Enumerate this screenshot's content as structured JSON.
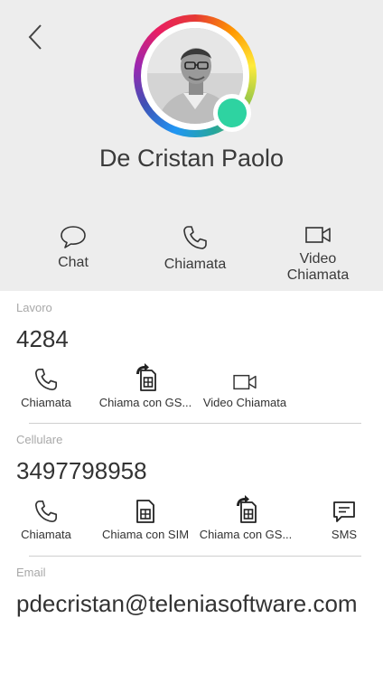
{
  "contact": {
    "name": "De Cristan Paolo",
    "status_color": "#2ed3a1"
  },
  "quick_actions": [
    {
      "label": "Chat",
      "icon": "chat-bubble-icon"
    },
    {
      "label": "Chiamata",
      "icon": "phone-icon"
    },
    {
      "label": "Video\nChiamata",
      "icon": "video-camera-icon"
    }
  ],
  "sections": {
    "work": {
      "label": "Lavoro",
      "value": "4284",
      "actions": [
        "Chiamata",
        "Chiama con GS...",
        "Video Chiamata"
      ]
    },
    "mobile": {
      "label": "Cellulare",
      "value": "3497798958",
      "actions": [
        "Chiamata",
        "Chiama con SIM",
        "Chiama con GS...",
        "SMS"
      ]
    },
    "email": {
      "label": "Email",
      "value": "pdecristan@teleniasoftware.com"
    }
  },
  "icons": {
    "back": "chevron-left-icon",
    "phone": "phone-icon",
    "sim": "sim-card-icon",
    "sim_forward": "sim-forward-icon",
    "video": "video-camera-icon",
    "sms": "message-icon"
  },
  "colors": {
    "header_bg": "#ededed",
    "status_online": "#2ed3a1"
  }
}
